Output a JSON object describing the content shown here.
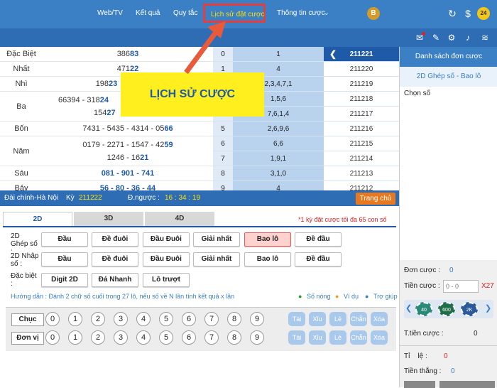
{
  "nav": {
    "webtv": "Web/TV",
    "ketqua": "Kết quả",
    "quytac": "Quy tắc",
    "lichsu": "Lịch sử đặt cược",
    "thongtin": "Thông tin cược",
    "avatar": "B"
  },
  "banner": "LỊCH SỬ CƯỢC",
  "results": [
    {
      "label": "Đặc Biệt",
      "lines": [
        {
          "a": "386",
          "b": "83"
        }
      ]
    },
    {
      "label": "Nhất",
      "lines": [
        {
          "a": "471",
          "b": "22"
        }
      ]
    },
    {
      "label": "Nhì",
      "lines": [
        {
          "a": "198",
          "b": "23"
        }
      ]
    },
    {
      "label": "Ba",
      "lines": [
        {
          "a": "66394 - 318",
          "b": "24"
        },
        {
          "a": "154",
          "b": "27"
        }
      ]
    },
    {
      "label": "Bốn",
      "lines": [
        {
          "a": "7431 - 5435 - 4314 - 05",
          "b": "66"
        }
      ]
    },
    {
      "label": "Năm",
      "lines": [
        {
          "a": "0179 - 2271 - 1547 - 42",
          "b": "59"
        },
        {
          "a": "1246 - 16",
          "b": "21"
        }
      ]
    },
    {
      "label": "Sáu",
      "lines": [
        {
          "a": "",
          "b": "081 - 901 - 741"
        }
      ]
    },
    {
      "label": "Bảy",
      "lines": [
        {
          "a": "",
          "b": "56 - 80 - 36 - 44"
        }
      ]
    }
  ],
  "digits": [
    {
      "n": "0",
      "d": "1"
    },
    {
      "n": "1",
      "d": "4"
    },
    {
      "n": "2",
      "d": "2,3,4,7,1"
    },
    {
      "n": "3",
      "d": "1,5,6"
    },
    {
      "n": "4",
      "d": "7,6,1,4"
    },
    {
      "n": "5",
      "d": "2,6,9,6"
    },
    {
      "n": "6",
      "d": "6,6"
    },
    {
      "n": "7",
      "d": "1,9,1"
    },
    {
      "n": "8",
      "d": "3,1,0"
    },
    {
      "n": "9",
      "d": "4"
    }
  ],
  "kys": [
    "211221",
    "211220",
    "211219",
    "211218",
    "211217",
    "211216",
    "211215",
    "211214",
    "211213",
    "211212"
  ],
  "infobar": {
    "dai": "Đài chính-Hà Nội",
    "ky_label": "Kỳ",
    "ky": "211222",
    "dn_label": "Đ.ngược :",
    "countdown": "16 : 34 : 19",
    "home": "Trang chủ"
  },
  "tabs": [
    "2D",
    "3D",
    "4D"
  ],
  "warn": "*1 kỳ đặt cược tối đa 65 con số",
  "groups": {
    "g1": "2D Ghép số :",
    "g2": "2D Nhập số :",
    "g3": "Đặc biệt :"
  },
  "row1": [
    "Đầu",
    "Đề đuôi",
    "Đầu Đuôi",
    "Giải nhất",
    "Bao lô",
    "Đề đầu"
  ],
  "row2": [
    "Đầu",
    "Đề đuôi",
    "Đầu Đuôi",
    "Giải nhất",
    "Bao lô",
    "Đề đầu"
  ],
  "row3": [
    "Digit 2D",
    "Đá Nhanh",
    "Lô trượt"
  ],
  "guide": "Hướng dẫn : Đánh 2 chữ số cuối trong 27 lô, nếu số về N lần tính kết quả x lần",
  "links": {
    "hot": "Số nóng",
    "ex": "Ví dụ",
    "help": "Trợ giúp"
  },
  "numrows": {
    "chuc": "Chục",
    "donvi": "Đơn vị"
  },
  "nums": [
    "0",
    "1",
    "2",
    "3",
    "4",
    "5",
    "6",
    "7",
    "8",
    "9"
  ],
  "quick": [
    "Tài",
    "Xỉu",
    "Lẻ",
    "Chẵn",
    "Xóa"
  ],
  "right": {
    "header": "Danh sách đơn cược",
    "sub": "2D Ghép số - Bao lô",
    "chon": "Chọn số",
    "don": "Đơn cược :",
    "don_val": "0",
    "tien": "Tiền cược :",
    "tien_ph": "0 - 0",
    "x": "X27",
    "tthuc": "T.tiền cược :",
    "tthuc_val": "0",
    "tile": "Tỉ    lệ :",
    "tile_val": "0",
    "thang": "Tiền thắng :",
    "thang_val": "0"
  },
  "chips": [
    "40",
    "600",
    "2K"
  ],
  "colors": {
    "accent": "#3b7fc4",
    "highlight": "#ffef1e",
    "red": "#e02020",
    "blue_num": "#1e5aa8"
  }
}
